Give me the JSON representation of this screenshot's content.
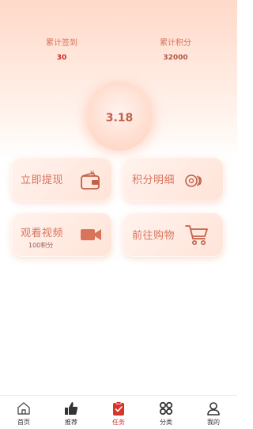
{
  "stats": {
    "days_label": "累计签到",
    "days_value": "30",
    "points_label": "累计积分",
    "points_value": "32000"
  },
  "circle": {
    "value": "3.18"
  },
  "cards": [
    {
      "label": "立即提现",
      "icon": "wallet-icon"
    },
    {
      "label": "积分明细",
      "icon": "coins-icon"
    },
    {
      "label": "观看视频",
      "sub": "100积分",
      "icon": "video-camera-icon"
    },
    {
      "label": "前往购物",
      "icon": "shopping-cart-icon"
    }
  ],
  "tabbar": {
    "items": [
      {
        "label": "首页",
        "icon": "home-icon"
      },
      {
        "label": "推荐",
        "icon": "thumbs-up-icon"
      },
      {
        "label": "任务",
        "icon": "task-icon",
        "active": true
      },
      {
        "label": "分类",
        "icon": "grid-icon"
      },
      {
        "label": "我的",
        "icon": "user-icon"
      }
    ]
  },
  "colors": {
    "accent": "#d9735a",
    "active_tab": "#d9342a",
    "card_bg": "#ffe8de"
  }
}
